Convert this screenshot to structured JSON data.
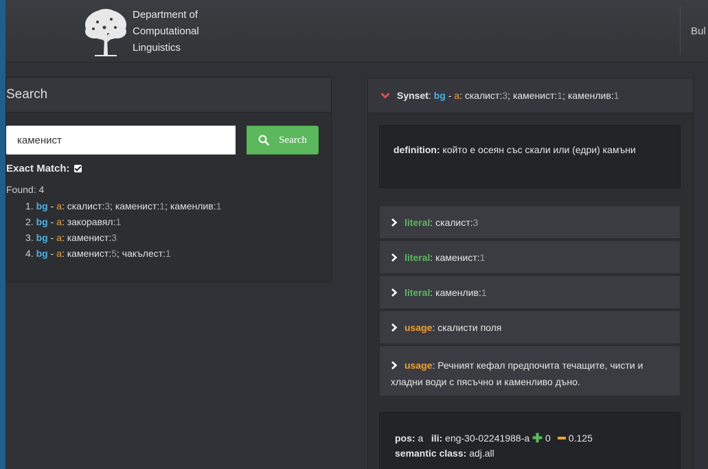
{
  "header": {
    "dept_line1": "Department of",
    "dept_line2": "Computational",
    "dept_line3": "Linguistics",
    "nav_link": "Bul"
  },
  "search": {
    "title": "Search",
    "input_value": "каменист",
    "button_label": "Search",
    "exact_match_label": "Exact Match:",
    "exact_match_checked": true,
    "found_label": "Found: 4",
    "results": [
      {
        "num": "1.",
        "lang": "bg",
        "dash": " - ",
        "pos": "a",
        "colon": ": ",
        "words": [
          {
            "w": "скалист",
            "i": "3"
          },
          {
            "w": "каменист",
            "i": "1"
          },
          {
            "w": "каменлив",
            "i": "1"
          }
        ]
      },
      {
        "num": "2.",
        "lang": "bg",
        "dash": " - ",
        "pos": "a",
        "colon": ": ",
        "words": [
          {
            "w": "закоравял",
            "i": "1"
          }
        ]
      },
      {
        "num": "3.",
        "lang": "bg",
        "dash": " - ",
        "pos": "a",
        "colon": ": ",
        "words": [
          {
            "w": "каменист",
            "i": "3"
          }
        ]
      },
      {
        "num": "4.",
        "lang": "bg",
        "dash": " - ",
        "pos": "a",
        "colon": ": ",
        "words": [
          {
            "w": "каменист",
            "i": "5"
          },
          {
            "w": "чакълест",
            "i": "1"
          }
        ]
      }
    ]
  },
  "synset": {
    "label": "Synset",
    "lang": "bg",
    "pos": "a",
    "words": [
      {
        "w": "скалист",
        "i": "3"
      },
      {
        "w": "каменист",
        "i": "1"
      },
      {
        "w": "каменлив",
        "i": "1"
      }
    ],
    "definition_label": "definition:",
    "definition_text": "който е осеян със скали или (едри) камъни",
    "items": [
      {
        "type": "literal",
        "label": "literal",
        "word": "скалист",
        "idx": "3"
      },
      {
        "type": "literal",
        "label": "literal",
        "word": "каменист",
        "idx": "1"
      },
      {
        "type": "literal",
        "label": "literal",
        "word": "каменлив",
        "idx": "1"
      },
      {
        "type": "usage",
        "label": "usage",
        "text": "скалисти поля"
      },
      {
        "type": "usage",
        "label": "usage",
        "text": "Речният кефал предпочита течащите, чисти и хладни води с пясъчно и каменливо дъно."
      }
    ],
    "pos_label": "pos:",
    "pos_value": "a",
    "ili_label": "ili:",
    "ili_value": "eng-30-02241988-a",
    "plus_value": "0",
    "minus_value": "0.125",
    "semantic_label": "semantic class:",
    "semantic_value": "adj.all"
  },
  "colors": {
    "accent_green": "#5cb85c",
    "lang_blue": "#4fb0e0",
    "pos_orange": "#f0a030",
    "chevron_red": "#e05050"
  }
}
